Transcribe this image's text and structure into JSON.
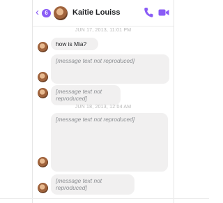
{
  "header": {
    "back_badge": "6",
    "contact_name": "Kaitie Louiss",
    "accent_color": "#8a5cf6",
    "icons": [
      "chevron-left-icon",
      "phone-icon",
      "video-camera-icon"
    ]
  },
  "timestamps": [
    "JUN 17, 2013, 11:01 PM",
    "JUN 18, 2013, 12:04 AM"
  ],
  "messages": [
    {
      "text": "how is Mia?"
    },
    {
      "text": "[message text not reproduced]"
    },
    {
      "text": "[message text not reproduced]"
    },
    {
      "text": "[message text not reproduced]"
    },
    {
      "text": "[message text not reproduced]"
    }
  ]
}
